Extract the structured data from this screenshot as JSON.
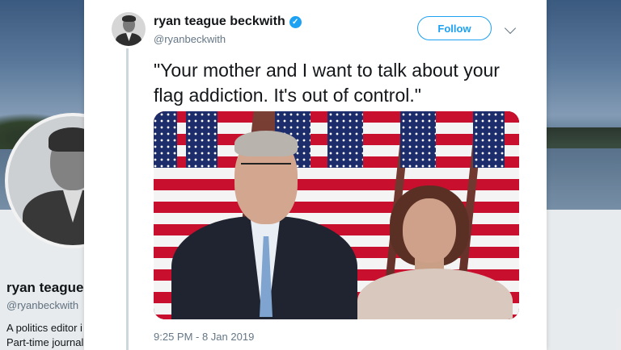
{
  "background_profile": {
    "name": "ryan teague",
    "handle": "@ryanbeckwith",
    "bio_line1": "A politics editor i",
    "bio_line2": "Part-time journal"
  },
  "tweet": {
    "display_name": "ryan teague beckwith",
    "handle": "@ryanbeckwith",
    "verified": true,
    "follow_label": "Follow",
    "text": "\"Your mother and I want to talk about your flag addiction. It's out of control.\"",
    "timestamp": "9:25 PM - 8 Jan 2019"
  },
  "colors": {
    "accent": "#1da1f2",
    "text_primary": "#14171a",
    "text_secondary": "#657786"
  },
  "icons": {
    "verified": "verified-badge-icon",
    "more": "chevron-down-icon"
  }
}
